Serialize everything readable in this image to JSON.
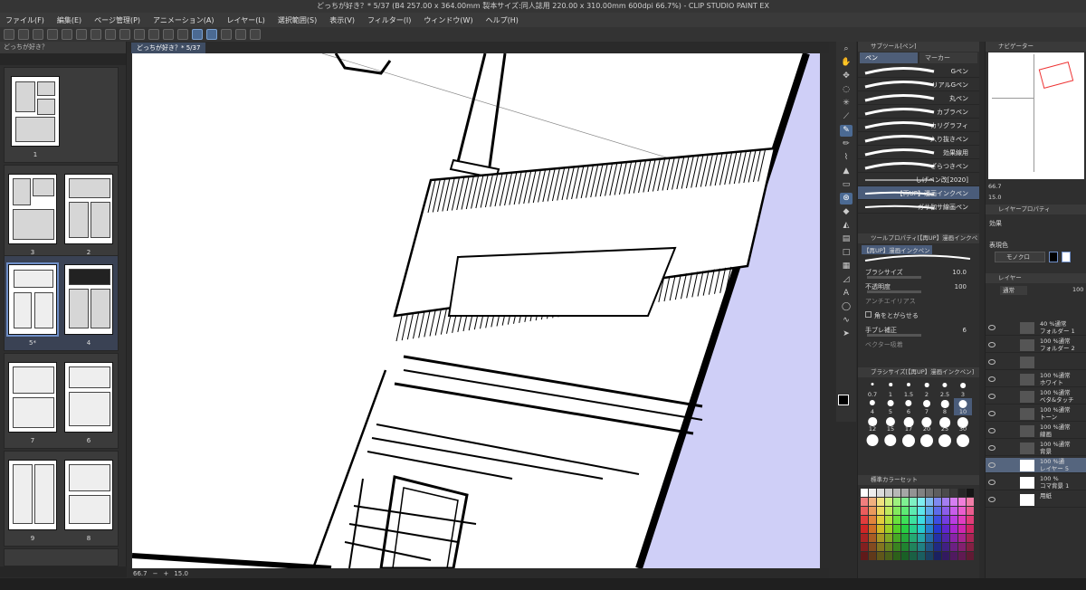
{
  "window": {
    "title": "どっちが好き？* 5/37 (B4 257.00 x 364.00mm 製本サイズ:同人誌用 220.00 x 310.00mm 600dpi 66.7%) - CLIP STUDIO PAINT EX"
  },
  "menu": [
    "ファイル(F)",
    "編集(E)",
    "ページ管理(P)",
    "アニメーション(A)",
    "レイヤー(L)",
    "選択範囲(S)",
    "表示(V)",
    "フィルター(I)",
    "ウィンドウ(W)",
    "ヘルプ(H)"
  ],
  "page_panel": {
    "tab": "どっちが好き？",
    "pages": [
      {
        "label": "1"
      },
      {
        "label": "3"
      },
      {
        "label": "2"
      },
      {
        "label": "5*"
      },
      {
        "label": "4"
      },
      {
        "label": "7"
      },
      {
        "label": "6"
      },
      {
        "label": "9"
      },
      {
        "label": "8"
      }
    ]
  },
  "canvas": {
    "tab": "どっちが好き？* 5/37",
    "zoom": "66.7",
    "rotation": "15.0"
  },
  "subtool": {
    "header": "サブツール[ペン]",
    "tabs": [
      "ペン",
      "マーカー"
    ],
    "brushes": [
      "Gペン",
      "リアルGペン",
      "丸ペン",
      "カブラペン",
      "カリグラフィ",
      "入り抜きペン",
      "効果線用",
      "ざらつきペン",
      "しげペン改[2020]",
      "【再UP】漫画インクペン",
      "ガサ伽サ線画ペン"
    ]
  },
  "tool_property": {
    "header": "ツールプロパティ[【再UP】漫画インクペン]",
    "name": "【再UP】漫画インクペン",
    "brush_size_label": "ブラシサイズ",
    "brush_size": "10.0",
    "opacity_label": "不透明度",
    "opacity": "100",
    "antialias_label": "アンチエイリアス",
    "corners_label": "角をとがらせる",
    "stabilization_label": "手ブレ補正",
    "stabilization": "6",
    "vector_label": "ベクター吸着"
  },
  "brush_size_panel": {
    "header": "ブラシサイズ[【再UP】漫画インクペン]",
    "sizes": [
      "0.7",
      "1",
      "1.5",
      "2",
      "2.5",
      "3",
      "4",
      "5",
      "6",
      "7",
      "8",
      "10",
      "12",
      "15",
      "17",
      "20",
      "25",
      "30",
      "",
      "",
      "",
      "",
      "",
      ""
    ]
  },
  "color_set": {
    "header": "標準カラーセット"
  },
  "navigator": {
    "header": "ナビゲーター",
    "zoom": "66.7",
    "rotation": "15.0"
  },
  "layer_property": {
    "header": "レイヤープロパティ",
    "effect_label": "効果",
    "expression_label": "表現色",
    "expression_value": "モノクロ"
  },
  "layers": {
    "header": "レイヤー",
    "blend": "通常",
    "opacity": "100",
    "items": [
      {
        "line1": "40 %通常",
        "line2": "フォルダー 1"
      },
      {
        "line1": "100 %通常",
        "line2": "フォルダー 2"
      },
      {
        "line1": "",
        "line2": ""
      },
      {
        "line1": "100 %通常",
        "line2": "ホワイト"
      },
      {
        "line1": "100 %通常",
        "line2": "ベタ&タッチ"
      },
      {
        "line1": "100 %通常",
        "line2": "トーン"
      },
      {
        "line1": "100 %通常",
        "line2": "線画"
      },
      {
        "line1": "100 %通常",
        "line2": "背景"
      },
      {
        "line1": "100 %通",
        "line2": "レイヤー 5"
      },
      {
        "line1": "100 %",
        "line2": "コマ背景 1"
      },
      {
        "line1": "",
        "line2": "用紙"
      }
    ]
  }
}
